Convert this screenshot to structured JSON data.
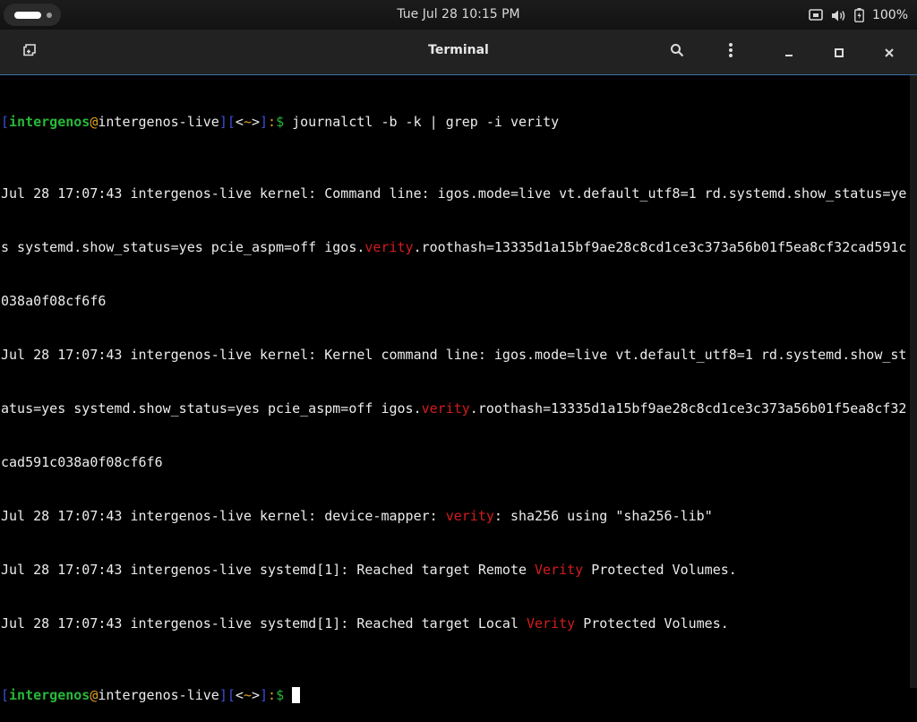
{
  "topbar": {
    "clock": "Tue Jul 28  10:15 PM",
    "battery_percent": "100%",
    "icons": [
      "activities-indicator",
      "network-icon",
      "volume-icon",
      "battery-icon"
    ]
  },
  "window": {
    "title": "Terminal",
    "buttons": [
      "new-tab-icon",
      "search-icon",
      "menu-dots-icon",
      "minimize-icon",
      "maximize-icon",
      "close-icon"
    ]
  },
  "prompt": {
    "open": "[",
    "user": "intergenos",
    "at": "@",
    "host": "intergenos-live",
    "mid": "][",
    "dir_open": "<",
    "dir": "~",
    "dir_close": ">",
    "close": "]",
    "colon": ":",
    "dollar": "$"
  },
  "command": " journalctl -b -k | grep -i verity",
  "output": [
    {
      "a": "Jul 28 17:07:43 intergenos-live kernel: Command line: igos.mode=live vt.default_utf8=1 rd.systemd.show_status=ye",
      "m": "",
      "b": ""
    },
    {
      "a": "s systemd.show_status=yes pcie_aspm=off igos.",
      "m": "verity",
      "b": ".roothash=13335d1a15bf9ae28c8cd1ce3c373a56b01f5ea8cf32cad591c"
    },
    {
      "a": "038a0f08cf6f6",
      "m": "",
      "b": ""
    },
    {
      "a": "Jul 28 17:07:43 intergenos-live kernel: Kernel command line: igos.mode=live vt.default_utf8=1 rd.systemd.show_st",
      "m": "",
      "b": ""
    },
    {
      "a": "atus=yes systemd.show_status=yes pcie_aspm=off igos.",
      "m": "verity",
      "b": ".roothash=13335d1a15bf9ae28c8cd1ce3c373a56b01f5ea8cf32"
    },
    {
      "a": "cad591c038a0f08cf6f6",
      "m": "",
      "b": ""
    },
    {
      "a": "Jul 28 17:07:43 intergenos-live kernel: device-mapper: ",
      "m": "verity",
      "b": ": sha256 using \"sha256-lib\""
    },
    {
      "a": "Jul 28 17:07:43 intergenos-live systemd[1]: Reached target Remote ",
      "m": "Verity",
      "b": " Protected Volumes."
    },
    {
      "a": "Jul 28 17:07:43 intergenos-live systemd[1]: Reached target Local ",
      "m": "Verity",
      "b": " Protected Volumes."
    }
  ]
}
